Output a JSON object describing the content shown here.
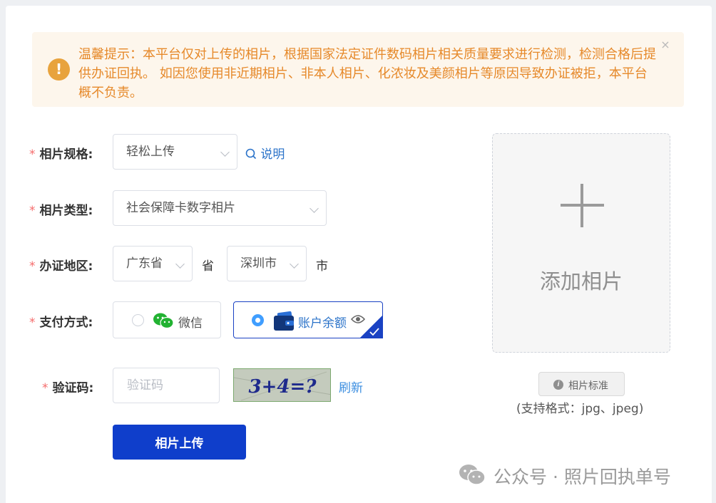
{
  "alert": {
    "icon": "exclamation-icon",
    "text": "温馨提示：本平台仅对上传的相片，根据国家法定证件数码相片相关质量要求进行检测，检测合格后提供办证回执。 如因您使用非近期相片、非本人相片、化浓妆及美颜相片等原因导致办证被拒，本平台概不负责。",
    "close": "×"
  },
  "form": {
    "required_mark": "*",
    "spec": {
      "label": "相片规格:",
      "value": "轻松上传",
      "help_link": "说明"
    },
    "type": {
      "label": "相片类型:",
      "value": "社会保障卡数字相片"
    },
    "region": {
      "label": "办证地区:",
      "province": "广东省",
      "province_suffix": "省",
      "city": "深圳市",
      "city_suffix": "市"
    },
    "payment": {
      "label": "支付方式:",
      "options": [
        {
          "label": "微信",
          "icon": "wechat-icon",
          "selected": false
        },
        {
          "label": "账户余额",
          "icon": "wallet-icon",
          "selected": true
        }
      ],
      "eye_icon": "eye-icon"
    },
    "captcha": {
      "label": "验证码:",
      "placeholder": "验证码",
      "image_text": "3+4=?",
      "refresh": "刷新"
    },
    "submit": "相片上传"
  },
  "upload": {
    "icon": "plus-icon",
    "label": "添加相片",
    "standard_button": "相片标准",
    "formats": "(支持格式：jpg、jpeg)"
  },
  "watermark": {
    "text": "公众号 · 照片回执单号",
    "icon": "wechat-logo-icon"
  },
  "colors": {
    "primary": "#0f3ecb",
    "alert_bg": "#fdf6ec",
    "alert_text": "#e6892a",
    "required": "#f56c6c",
    "link": "#2b73c9"
  }
}
